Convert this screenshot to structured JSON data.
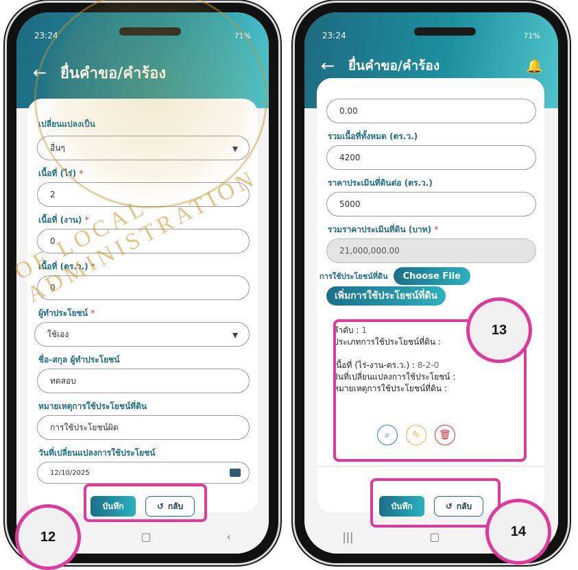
{
  "left": {
    "status_time": "23:24",
    "status_right": "71%",
    "title": "ยื่นคำขอ/คำร้อง",
    "fields": [
      {
        "label": "เปลี่ยนแปลงเป็น",
        "required": false,
        "value": "อื่นๆ",
        "type": "select"
      },
      {
        "label": "เนื้อที่ (ไร่)",
        "required": true,
        "value": "2",
        "type": "text"
      },
      {
        "label": "เนื้อที่ (งาน)",
        "required": true,
        "value": "0",
        "type": "text"
      },
      {
        "label": "เนื้อที่ (ตร.ว.)",
        "required": true,
        "value": "0",
        "type": "text"
      },
      {
        "label": "ผู้ทำประโยชน์",
        "required": true,
        "value": "ใช้เอง",
        "type": "select"
      },
      {
        "label": "ชื่อ-สกุล ผู้ทำประโยชน์",
        "required": false,
        "value": "ทดสอบ",
        "type": "text"
      },
      {
        "label": "หมายเหตุการใช้ประโยชน์ที่ดิน",
        "required": false,
        "value": "การใช้ประโยชน์ผิด",
        "type": "text"
      },
      {
        "label": "วันที่เปลี่ยนแปลงการใช้ประโยชน์",
        "required": false,
        "value": "12/10/2025",
        "type": "date"
      }
    ],
    "save_label": "บันทึก",
    "back_label": "กลับ",
    "badge": "12"
  },
  "right": {
    "status_time": "23:24",
    "status_right": "71%",
    "title": "ยื่นคำขอ/คำร้อง",
    "top_value": "0.00",
    "total_area_label": "รวมเนื้อที่ทั้งหมด (ตร.ว.)",
    "total_area_value": "4200",
    "price_label": "ราคาประเมินที่ดินต่อ (ตร.ว.)",
    "price_value": "5000",
    "total_price_label": "รวมราคาประเมินที่ดิน (บาท)",
    "total_price_value": "21,000,000.00",
    "land_use_label": "การใช้ประโยชน์ที่ดิน",
    "choose_file_label": "Choose File",
    "add_usage_label": "เพิ่มการใช้ประโยชน์ที่ดิน",
    "info": {
      "order_label": "ลำดับ :",
      "order_value": "1",
      "type_label": "ประเภทการใช้ประโยชน์ที่ดิน :",
      "area_label": "เนื้อที่ (ไร่-งาน-ตร.ว.) :",
      "area_value": "8-2-0",
      "change_date_label": "วันที่เปลี่ยนแปลงการใช้ประโยชน์ :",
      "remark_label": "หมายเหตุการใช้ประโยชน์ที่ดิน :"
    },
    "save_label": "บันทึก",
    "back_label": "กลับ",
    "badge_info": "13",
    "badge_buttons": "14"
  },
  "watermark_text": "OF LOCAL ADMINISTRATION",
  "colors": {
    "accent": "#1c8f9e",
    "highlight": "#e0399e",
    "label": "#1c6d86"
  },
  "icons": [
    "back-arrow-icon",
    "bell-icon",
    "search-icon",
    "edit-icon",
    "trash-icon",
    "calendar-icon",
    "undo-icon"
  ]
}
